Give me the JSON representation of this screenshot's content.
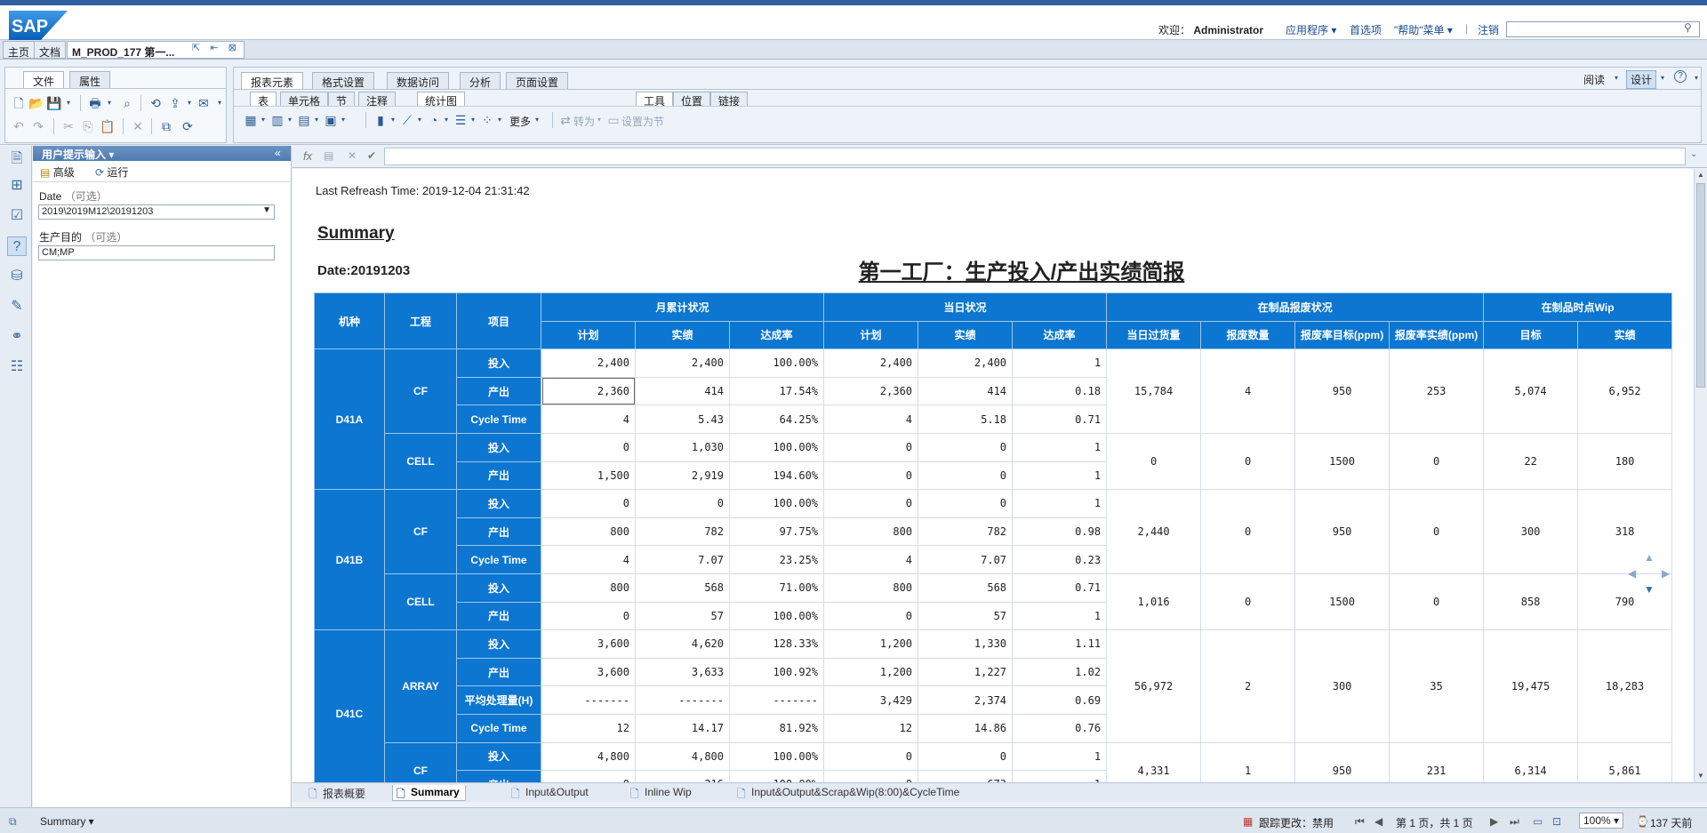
{
  "header": {
    "logo_text": "SAP",
    "welcome_prefix": "欢迎：",
    "user": "Administrator",
    "links": [
      "应用程序 ▾",
      "首选项",
      "\"帮助\"菜单 ▾",
      "|",
      "注销"
    ]
  },
  "app_tabs": [
    "主页",
    "文档",
    "M_PROD_177 第一..."
  ],
  "ribbon": {
    "left_tabs": [
      "文件",
      "属性"
    ],
    "main_tabs": [
      "报表元素",
      "格式设置",
      "数据访问",
      "分析",
      "页面设置"
    ],
    "sub_tabs_1": [
      "表",
      "单元格",
      "节",
      "注释"
    ],
    "sub_tabs_2": [
      "统计图"
    ],
    "sub_tabs_3": [
      "工具",
      "位置",
      "链接"
    ],
    "more": "更多",
    "turn_to": "转为",
    "set_section": "设置为节",
    "mode_read": "阅读",
    "mode_design": "设计",
    "help": "?"
  },
  "left_panel": {
    "title": "用户提示输入",
    "advanced": "高级",
    "run": "运行",
    "date_label": "Date",
    "optional": "（可选）",
    "date_value": "2019\\2019M12\\20191203",
    "purpose_label": "生产目的",
    "purpose_value": "CM;MP"
  },
  "formula": {
    "fx": "fx"
  },
  "report": {
    "refresh": "Last Refreash Time: 2019-12-04 21:31:42",
    "summary": "Summary",
    "date": "Date:20191203",
    "title": "第一工厂：生产投入/产出实绩简报",
    "headers": {
      "machine": "机种",
      "process": "工程",
      "item": "项目",
      "monthly": "月累计状况",
      "daily": "当日状况",
      "wip_scrap": "在制品报废状况",
      "wip_time": "在制品时点Wip",
      "plan": "计划",
      "actual": "实绩",
      "rate": "达成率",
      "daily_over": "当日过货量",
      "scrap_qty": "报废数量",
      "scrap_target": "报废率目标(ppm)",
      "scrap_actual": "报废率实绩(ppm)",
      "target": "目标",
      "wip_actual": "实绩"
    },
    "groups": [
      {
        "machine": "D41A",
        "rows": 5
      },
      {
        "machine": "D41B",
        "rows": 5
      },
      {
        "machine": "D41C",
        "rows": 6
      }
    ],
    "processes": [
      {
        "name": "CF",
        "rows": 3,
        "wip": [
          "15,784",
          "4",
          "950",
          "253",
          "5,074",
          "6,952"
        ]
      },
      {
        "name": "CELL",
        "rows": 2,
        "wip": [
          "0",
          "0",
          "1500",
          "0",
          "22",
          "180"
        ]
      },
      {
        "name": "CF",
        "rows": 3,
        "wip": [
          "2,440",
          "0",
          "950",
          "0",
          "300",
          "318"
        ]
      },
      {
        "name": "CELL",
        "rows": 2,
        "wip": [
          "1,016",
          "0",
          "1500",
          "0",
          "858",
          "790"
        ]
      },
      {
        "name": "ARRAY",
        "rows": 4,
        "wip": [
          "56,972",
          "2",
          "300",
          "35",
          "19,475",
          "18,283"
        ]
      },
      {
        "name": "CF",
        "rows": 2,
        "wip": [
          "4,331",
          "1",
          "950",
          "231",
          "6,314",
          "5,861"
        ]
      }
    ],
    "rows": [
      [
        "投入",
        "2,400",
        "2,400",
        "100.00%",
        "2,400",
        "2,400",
        "1"
      ],
      [
        "产出",
        "2,360",
        "414",
        "17.54%",
        "2,360",
        "414",
        "0.18"
      ],
      [
        "Cycle Time",
        "4",
        "5.43",
        "64.25%",
        "4",
        "5.18",
        "0.71"
      ],
      [
        "投入",
        "0",
        "1,030",
        "100.00%",
        "0",
        "0",
        "1"
      ],
      [
        "产出",
        "1,500",
        "2,919",
        "194.60%",
        "0",
        "0",
        "1"
      ],
      [
        "投入",
        "0",
        "0",
        "100.00%",
        "0",
        "0",
        "1"
      ],
      [
        "产出",
        "800",
        "782",
        "97.75%",
        "800",
        "782",
        "0.98"
      ],
      [
        "Cycle Time",
        "4",
        "7.07",
        "23.25%",
        "4",
        "7.07",
        "0.23"
      ],
      [
        "投入",
        "800",
        "568",
        "71.00%",
        "800",
        "568",
        "0.71"
      ],
      [
        "产出",
        "0",
        "57",
        "100.00%",
        "0",
        "57",
        "1"
      ],
      [
        "投入",
        "3,600",
        "4,620",
        "128.33%",
        "1,200",
        "1,330",
        "1.11"
      ],
      [
        "产出",
        "3,600",
        "3,633",
        "100.92%",
        "1,200",
        "1,227",
        "1.02"
      ],
      [
        "平均处理量(H)",
        "-------",
        "-------",
        "-------",
        "3,429",
        "2,374",
        "0.69"
      ],
      [
        "Cycle Time",
        "12",
        "14.17",
        "81.92%",
        "12",
        "14.86",
        "0.76"
      ],
      [
        "投入",
        "4,800",
        "4,800",
        "100.00%",
        "0",
        "0",
        "1"
      ],
      [
        "产出",
        "0",
        "216",
        "100.00%",
        "0",
        "673",
        "1"
      ]
    ]
  },
  "bottom_tabs": [
    "报表概要",
    "Summary",
    "Input&Output",
    "Inline Wip",
    "Input&Output&Scrap&Wip(8:00)&CycleTime"
  ],
  "status": {
    "left": "Summary",
    "track": "跟踪更改：禁用",
    "pages": "第 1 页，共 1 页",
    "zoom": "100%",
    "right": "137 天前"
  }
}
